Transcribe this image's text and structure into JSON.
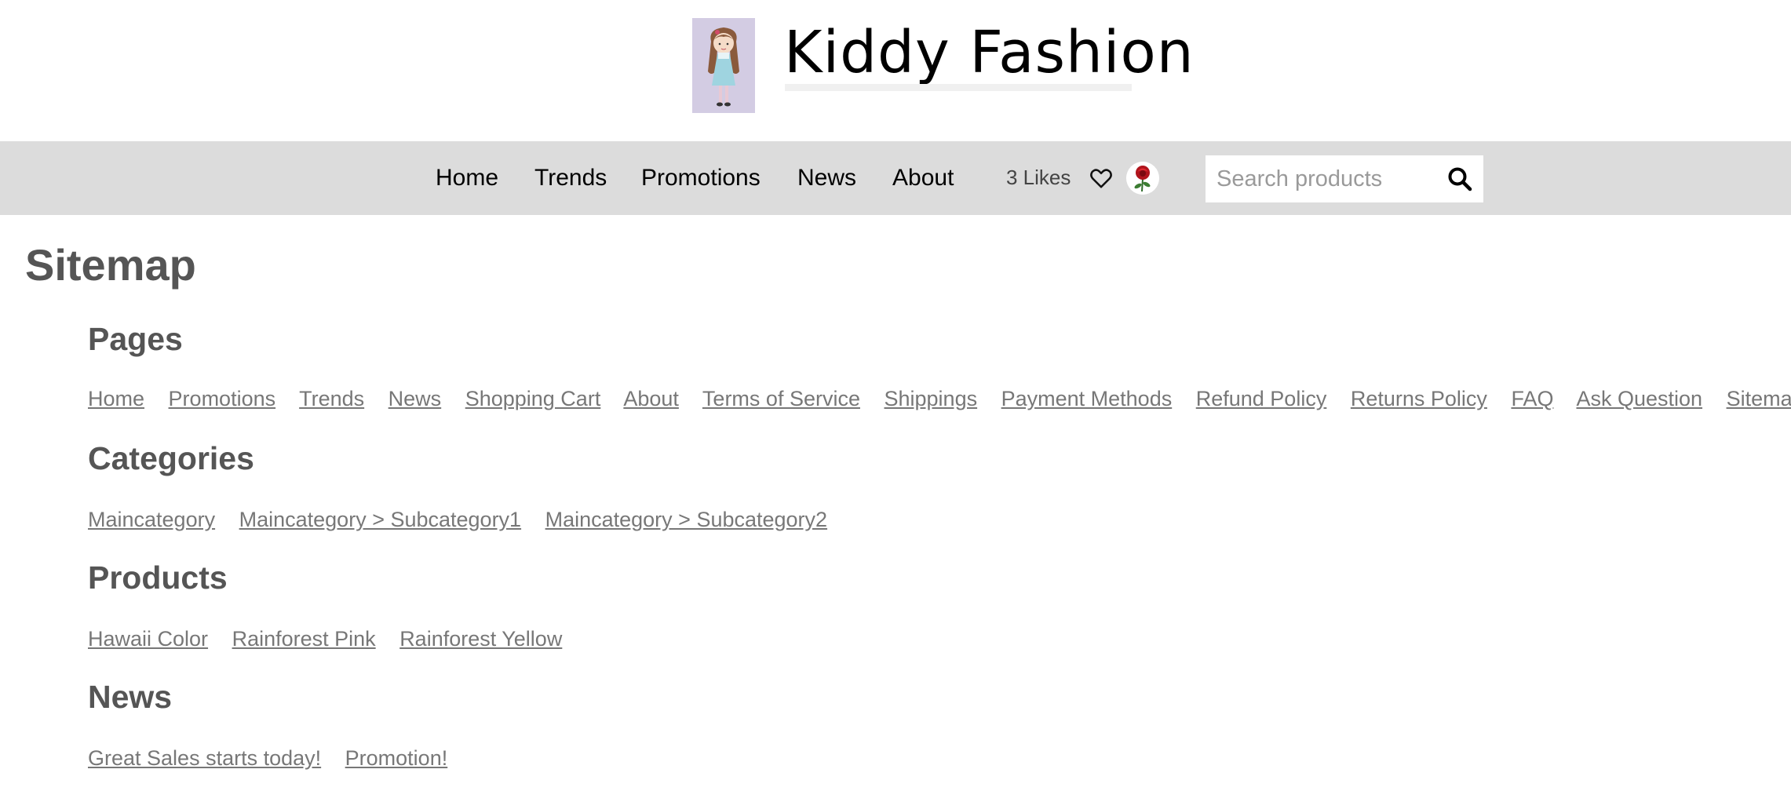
{
  "header": {
    "site_title": "Kiddy Fashion",
    "logo_icon": "girl-doll-illustration"
  },
  "nav": {
    "items": [
      {
        "label": "Home"
      },
      {
        "label": "Trends"
      },
      {
        "label": "Promotions"
      },
      {
        "label": "News"
      },
      {
        "label": "About"
      }
    ],
    "likes_text": "3 Likes",
    "heart_icon": "heart-icon",
    "avatar_icon": "rose-avatar",
    "search": {
      "value": "",
      "placeholder": "Search products",
      "icon": "search-icon"
    }
  },
  "sitemap": {
    "title": "Sitemap",
    "sections": [
      {
        "title": "Pages",
        "links": [
          "Home",
          "Promotions",
          "Trends",
          "News",
          "Shopping Cart",
          "About",
          "Terms of Service",
          "Shippings",
          "Payment Methods",
          "Refund Policy",
          "Returns Policy",
          "FAQ",
          "Ask Question",
          "Sitemap"
        ]
      },
      {
        "title": "Categories",
        "links": [
          "Maincategory",
          "Maincategory > Subcategory1",
          "Maincategory > Subcategory2"
        ]
      },
      {
        "title": "Products",
        "links": [
          "Hawaii Color",
          "Rainforest Pink",
          "Rainforest Yellow"
        ]
      },
      {
        "title": "News",
        "links": [
          "Great Sales starts today!",
          "Promotion!"
        ]
      }
    ]
  },
  "colors": {
    "nav_background": "#dcdcdc",
    "heading_text": "#555555",
    "link_text": "#777777",
    "logo_background": "#d3cce3"
  }
}
